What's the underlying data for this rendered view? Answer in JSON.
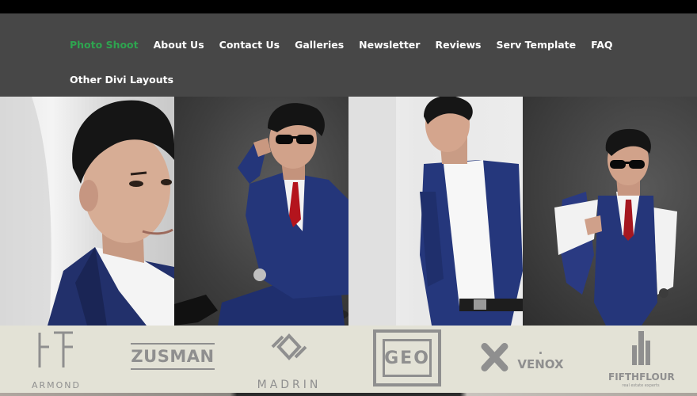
{
  "nav": {
    "items": [
      {
        "label": "Photo Shoot",
        "active": true
      },
      {
        "label": "About Us"
      },
      {
        "label": "Contact Us"
      },
      {
        "label": "Galleries"
      },
      {
        "label": "Newsletter"
      },
      {
        "label": "Reviews"
      },
      {
        "label": "Serv Template"
      },
      {
        "label": "FAQ"
      }
    ],
    "items_row2": [
      {
        "label": "Other Divi Layouts"
      }
    ],
    "active_color": "#2ea44f"
  },
  "gallery": {
    "photos": [
      {
        "description_icon": "portrait-closeup-photo"
      },
      {
        "description_icon": "seated-sunglasses-photo"
      },
      {
        "description_icon": "leaning-wall-photo"
      },
      {
        "description_icon": "jacket-over-shoulder-photo"
      }
    ]
  },
  "logos": {
    "items": [
      {
        "name": "ARMOND"
      },
      {
        "name": "ZUSMAN"
      },
      {
        "name": "MADRIN"
      },
      {
        "name": "GEO"
      },
      {
        "name": ". VENOX"
      },
      {
        "name": "FIFTHFLOUR",
        "tagline": "real estate experts"
      }
    ]
  }
}
